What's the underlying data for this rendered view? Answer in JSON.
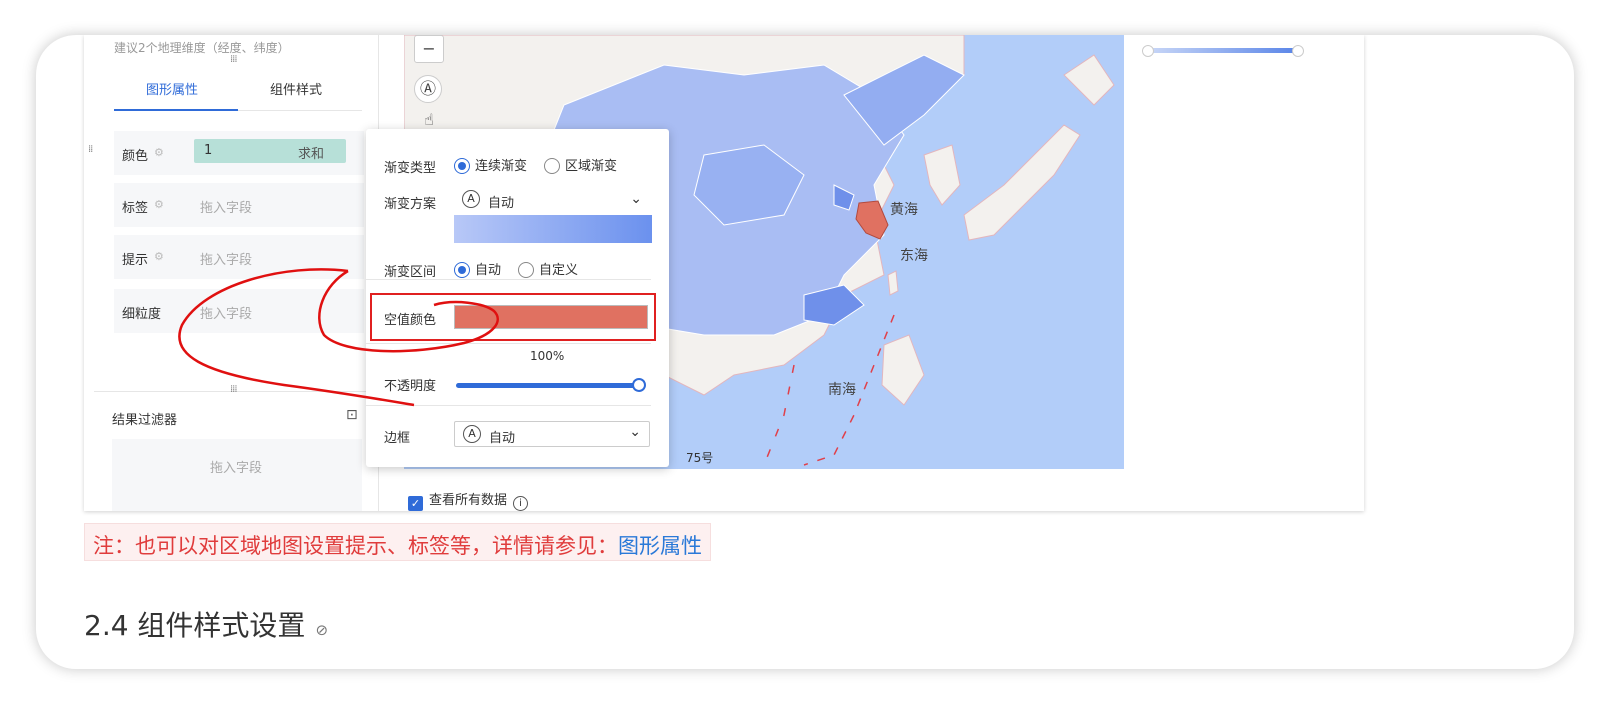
{
  "left_panel": {
    "hint": "建议2个地理维度（经度、纬度）",
    "tabs": [
      {
        "label": "图形属性"
      },
      {
        "label": "组件样式"
      }
    ],
    "fields": [
      {
        "label": "颜色",
        "value": "1",
        "agg": "求和"
      },
      {
        "label": "标签",
        "placeholder": "拖入字段"
      },
      {
        "label": "提示",
        "placeholder": "拖入字段"
      },
      {
        "label": "细粒度",
        "placeholder": "拖入字段"
      }
    ],
    "filter_title": "结果过滤器",
    "filter_placeholder": "拖入字段"
  },
  "popup": {
    "gradient_type_label": "渐变类型",
    "gradient_type_options": [
      "连续渐变",
      "区域渐变"
    ],
    "gradient_scheme_label": "渐变方案",
    "gradient_scheme_value": "自动",
    "gradient_range_label": "渐变区间",
    "gradient_range_options": [
      "自动",
      "自定义"
    ],
    "null_color_label": "空值颜色",
    "null_color": "#e07161",
    "opacity_pct": "100%",
    "opacity_label": "不透明度",
    "border_label": "边框",
    "border_value": "自动"
  },
  "map": {
    "labels": [
      "黄海",
      "东海",
      "南海"
    ],
    "attribution_fragment": "75号",
    "show_all_label": "查看所有数据",
    "zoom_out": "−",
    "colors": {
      "sea": "#b2cdf9",
      "land": "#f4f2ef",
      "region": "#a9bdf3",
      "region_dark": "#7f9cef",
      "highlight": "#e07161"
    }
  },
  "note": {
    "text": "注：也可以对区域地图设置提示、标签等，详情请参见：",
    "link": "图形属性"
  },
  "heading": "2.4 组件样式设置"
}
